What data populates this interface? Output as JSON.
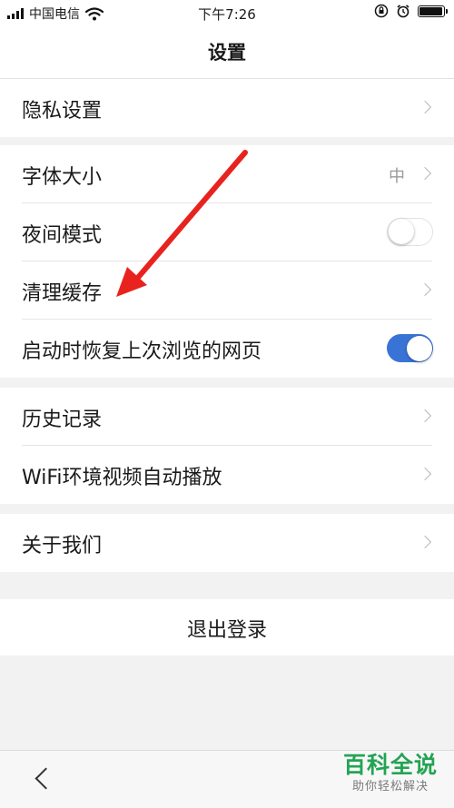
{
  "status_bar": {
    "carrier": "中国电信",
    "time": "下午7:26",
    "battery_level": 0.95,
    "icons": [
      "signal-icon",
      "wifi-icon",
      "orientation-lock-icon",
      "alarm-icon",
      "battery-icon"
    ]
  },
  "nav": {
    "title": "设置"
  },
  "groups": [
    {
      "items": [
        {
          "label": "隐私设置",
          "accessory": "chevron"
        }
      ]
    },
    {
      "items": [
        {
          "label": "字体大小",
          "value": "中",
          "accessory": "chevron"
        },
        {
          "label": "夜间模式",
          "accessory": "toggle",
          "on": false
        },
        {
          "label": "清理缓存",
          "accessory": "chevron"
        },
        {
          "label": "启动时恢复上次浏览的网页",
          "accessory": "toggle",
          "on": true
        }
      ]
    },
    {
      "items": [
        {
          "label": "历史记录",
          "accessory": "chevron"
        },
        {
          "label": "WiFi环境视频自动播放",
          "accessory": "chevron"
        }
      ]
    },
    {
      "items": [
        {
          "label": "关于我们",
          "accessory": "chevron"
        }
      ]
    }
  ],
  "logout": {
    "label": "退出登录"
  },
  "bottom_bar": {
    "back_icon": "chevron-left-icon"
  },
  "annotation": {
    "arrow_color": "#e8231f",
    "points_to": "清理缓存"
  },
  "watermark": {
    "brand": "百科全说",
    "slogan": "助你轻松解决",
    "color": "#23a453"
  },
  "colors": {
    "toggle_on": "#3a73d6",
    "background": "#f2f2f3"
  }
}
